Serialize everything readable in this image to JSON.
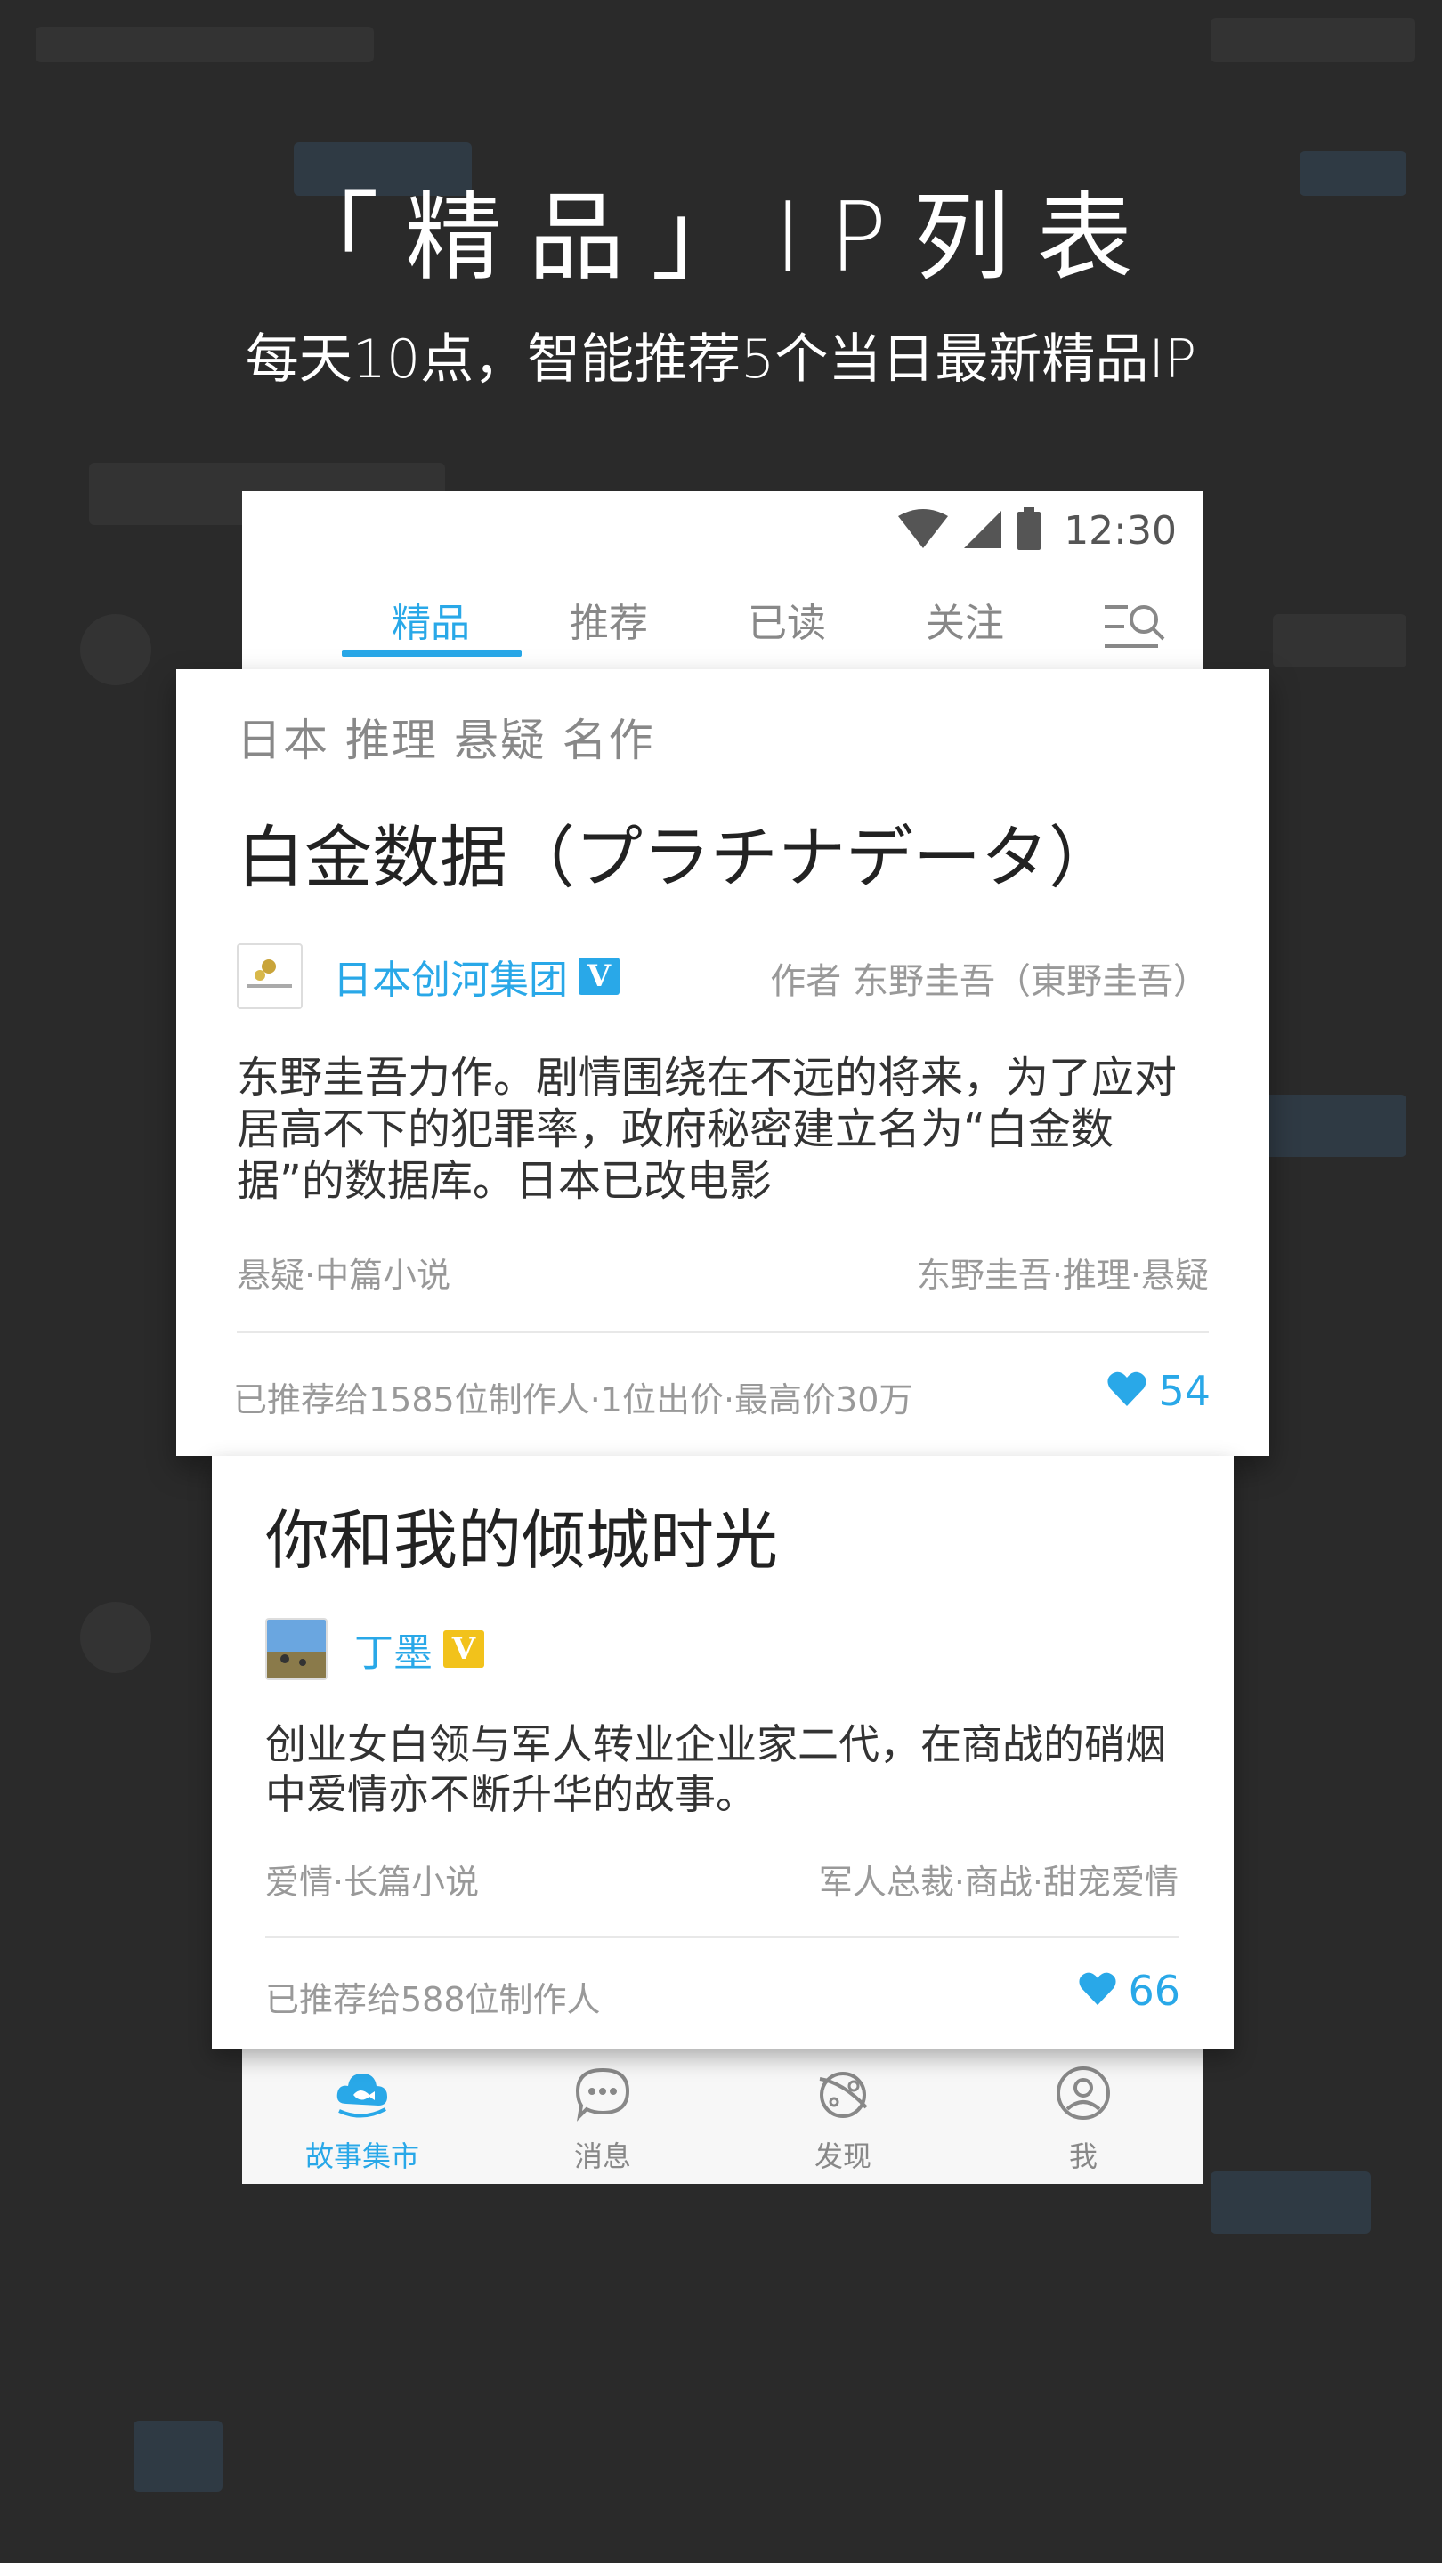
{
  "promo": {
    "title": "「精品」IP列表",
    "subtitle": "每天10点，智能推荐5个当日最新精品IP"
  },
  "status_bar": {
    "time": "12:30"
  },
  "tabs": [
    {
      "label": "精品",
      "active": true
    },
    {
      "label": "推荐",
      "active": false
    },
    {
      "label": "已读",
      "active": false
    },
    {
      "label": "关注",
      "active": false
    }
  ],
  "cards": [
    {
      "tags": "日本 推理 悬疑 名作",
      "title": "白金数据（プラチナデータ）",
      "publisher": "日本创河集团",
      "verify": "V",
      "author": "作者 东野圭吾（東野圭吾）",
      "description": "东野圭吾力作。剧情围绕在不远的将来，为了应对居高不下的犯罪率，政府秘密建立名为“白金数据”的数据库。日本已改电影",
      "genre": "悬疑·中篇小说",
      "keywords": "东野圭吾·推理·悬疑",
      "stats": "已推荐给1585位制作人·1位出价·最高价30万",
      "likes": "54"
    },
    {
      "title": "你和我的倾城时光",
      "publisher": "丁墨",
      "verify": "V",
      "description": "创业女白领与军人转业企业家二代，在商战的硝烟中爱情亦不断升华的故事。",
      "genre": "爱情·长篇小说",
      "keywords": "军人总裁·商战·甜宠爱情",
      "stats": "已推荐给588位制作人",
      "likes": "66"
    }
  ],
  "bottom_nav": [
    {
      "label": "故事集市",
      "icon": "story-market-icon",
      "active": true
    },
    {
      "label": "消息",
      "icon": "message-icon",
      "active": false
    },
    {
      "label": "发现",
      "icon": "discover-icon",
      "active": false
    },
    {
      "label": "我",
      "icon": "profile-icon",
      "active": false
    }
  ],
  "colors": {
    "accent": "#29a8e8",
    "gold": "#f2c21b",
    "background": "#2a2a2a"
  }
}
